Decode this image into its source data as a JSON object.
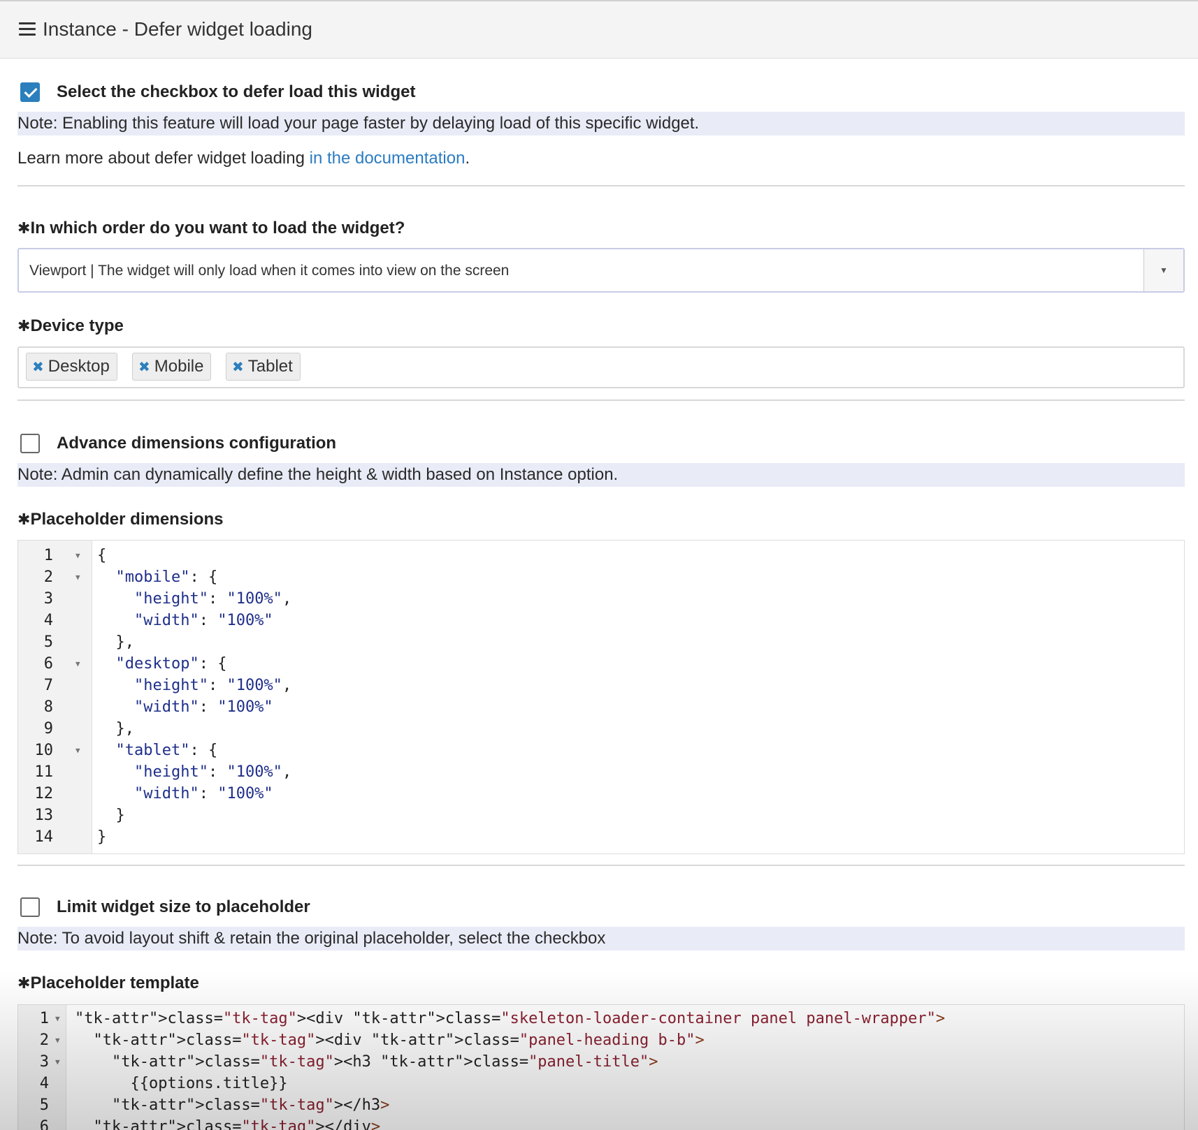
{
  "header": {
    "title": "Instance - Defer widget loading"
  },
  "defer": {
    "checkbox_label": "Select the checkbox to defer load this widget",
    "checked": true,
    "note": "Note: Enabling this feature will load your page faster by delaying load of this specific widget.",
    "learn_prefix": "Learn more about defer widget loading ",
    "learn_link": "in the documentation",
    "learn_suffix": "."
  },
  "order": {
    "required_mark": "✱",
    "label": "In which order do you want to load the widget?",
    "selected": "Viewport | The widget will only load when it comes into view on the screen"
  },
  "device": {
    "required_mark": "✱",
    "label": "Device type",
    "tags": [
      "Desktop",
      "Mobile",
      "Tablet"
    ],
    "remove_glyph": "✖"
  },
  "advance": {
    "checkbox_label": "Advance dimensions configuration",
    "checked": false,
    "note": "Note: Admin can dynamically define the height & width based on Instance option."
  },
  "placeholder_dimensions": {
    "required_mark": "✱",
    "label": "Placeholder dimensions",
    "lines": [
      {
        "num": "1",
        "fold": true,
        "text": "{"
      },
      {
        "num": "2",
        "fold": true,
        "text": "  \"mobile\": {"
      },
      {
        "num": "3",
        "fold": false,
        "text": "    \"height\": \"100%\","
      },
      {
        "num": "4",
        "fold": false,
        "text": "    \"width\": \"100%\""
      },
      {
        "num": "5",
        "fold": false,
        "text": "  },"
      },
      {
        "num": "6",
        "fold": true,
        "text": "  \"desktop\": {"
      },
      {
        "num": "7",
        "fold": false,
        "text": "    \"height\": \"100%\","
      },
      {
        "num": "8",
        "fold": false,
        "text": "    \"width\": \"100%\""
      },
      {
        "num": "9",
        "fold": false,
        "text": "  },"
      },
      {
        "num": "10",
        "fold": true,
        "text": "  \"tablet\": {"
      },
      {
        "num": "11",
        "fold": false,
        "text": "    \"height\": \"100%\","
      },
      {
        "num": "12",
        "fold": false,
        "text": "    \"width\": \"100%\""
      },
      {
        "num": "13",
        "fold": false,
        "text": "  }"
      },
      {
        "num": "14",
        "fold": false,
        "text": "}"
      }
    ]
  },
  "limit": {
    "checkbox_label": "Limit widget size to placeholder",
    "checked": false,
    "note": "Note: To avoid layout shift & retain the original placeholder, select the checkbox"
  },
  "placeholder_template": {
    "required_mark": "✱",
    "label": "Placeholder template",
    "lines": [
      {
        "num": "1",
        "fold": true,
        "text": "<div class=\"skeleton-loader-container panel panel-wrapper\">"
      },
      {
        "num": "2",
        "fold": true,
        "text": "  <div class=\"panel-heading b-b\">"
      },
      {
        "num": "3",
        "fold": true,
        "text": "    <h3 class=\"panel-title\">"
      },
      {
        "num": "4",
        "fold": false,
        "text": "      {{options.title}}"
      },
      {
        "num": "5",
        "fold": false,
        "text": "    </h3>"
      },
      {
        "num": "6",
        "fold": false,
        "text": "  </div>"
      }
    ]
  },
  "icons": {
    "menu": "hamburger-menu-icon",
    "fold": "fold-arrow-icon",
    "dropdown": "caret-down-icon",
    "remove": "remove-x-icon",
    "check": "checkmark-icon"
  },
  "colors": {
    "accent": "#2b7fbd",
    "link": "#2c7cc2",
    "note_bg": "#e9ecf7"
  }
}
